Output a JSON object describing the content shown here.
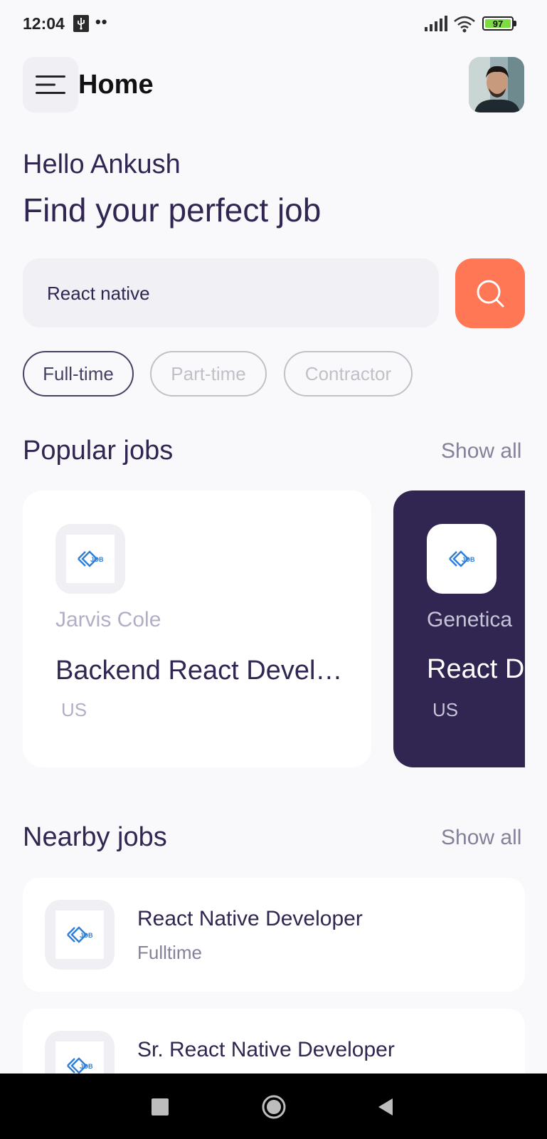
{
  "status_bar": {
    "time": "12:04",
    "dots": "••",
    "battery": "97",
    "icons": [
      "usb-icon",
      "signal-icon",
      "wifi-icon",
      "battery-icon"
    ]
  },
  "header": {
    "title": "Home",
    "menu_icon": "menu-icon",
    "avatar": "profile-avatar"
  },
  "welcome": {
    "greeting": "Hello Ankush",
    "headline": "Find your perfect job"
  },
  "search": {
    "value": "React native",
    "button_icon": "search-icon"
  },
  "job_types": [
    {
      "label": "Full-time",
      "active": true
    },
    {
      "label": "Part-time",
      "active": false
    },
    {
      "label": "Contractor",
      "active": false
    }
  ],
  "popular": {
    "title": "Popular jobs",
    "show_all": "Show all",
    "cards": [
      {
        "company": "Jarvis Cole",
        "title": "Backend React Devel…",
        "location": "US"
      },
      {
        "company": "Genetica",
        "title": "React De",
        "location": "US"
      }
    ]
  },
  "nearby": {
    "title": "Nearby jobs",
    "show_all": "Show all",
    "items": [
      {
        "title": "React Native Developer",
        "type": "Fulltime"
      },
      {
        "title": "Sr. React Native Developer",
        "type": ""
      }
    ]
  },
  "logo_text": "JOB",
  "colors": {
    "primary": "#312651",
    "accent": "#ff7754",
    "background": "#f9f9fc",
    "gray": "#83829a",
    "logo_blue": "#2f7ed8"
  },
  "navbar": {
    "buttons": [
      "recents-button",
      "home-button",
      "back-button"
    ]
  }
}
